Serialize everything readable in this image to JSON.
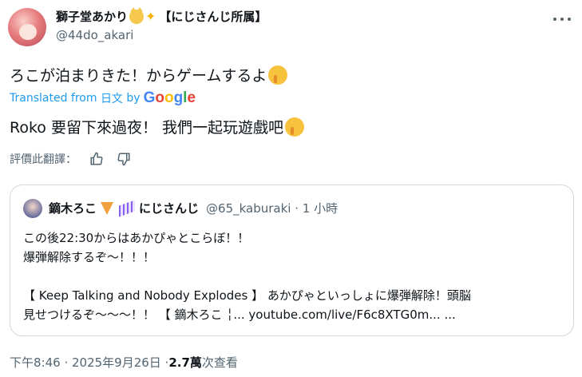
{
  "author": {
    "display_name": "獅子堂あかり",
    "affiliation": "【にじさんじ所属】",
    "handle": "@44do_akari"
  },
  "post": {
    "text": "ろこが泊まりきた！からゲームするよ",
    "translated_prefix": "Translated from",
    "translated_lang": "日文",
    "translated_by": "by",
    "google_letters": [
      "G",
      "o",
      "o",
      "g",
      "l",
      "e"
    ],
    "translation": "Roko 要留下來過夜！ 我們一起玩遊戲吧"
  },
  "rate_translation": "評價此翻譯：",
  "quoted": {
    "display_name": "鏑木ろこ",
    "affiliation": "にじさんじ",
    "meta": "@65_kaburaki · 1 小時",
    "lines": [
      "この後22:30からはあかぴゃとこらぼ！！",
      "爆弾解除するぞ～！！！",
      "",
      "【 Keep Talking and Nobody Explodes 】 あかぴゃといっしょに爆弾解除！頭脳",
      "見せつけるぞ～～～！！ 【 鏑木ろこ ╎... youtube.com/live/F6c8XTG0m... ..."
    ]
  },
  "footer": {
    "time": "下午8:46 · 2025年9月26日 · ",
    "views": "2.7萬",
    "views_label": " 次查看"
  },
  "icons": {
    "more": "more-icon",
    "thumbs_up": "thumbs-up-icon",
    "thumbs_down": "thumbs-down-icon"
  },
  "colors": {
    "link": "#1d9bf0",
    "secondary": "#536471",
    "primary": "#0f1419",
    "border": "#cfd9de"
  }
}
